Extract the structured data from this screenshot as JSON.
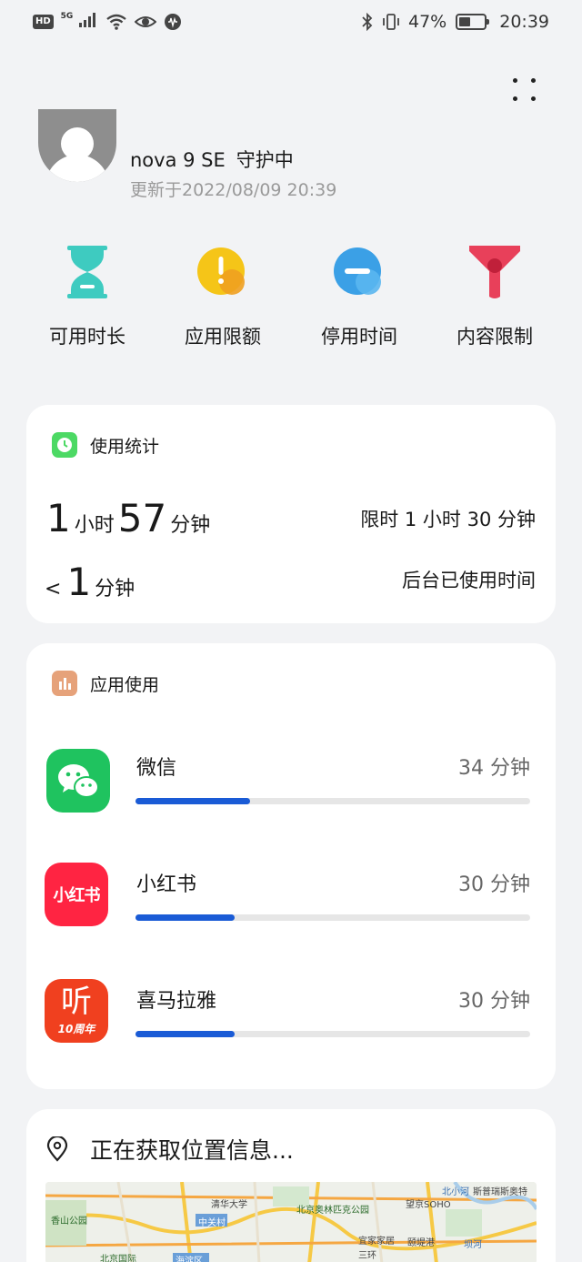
{
  "status_bar": {
    "hd": "HD",
    "signal_label": "5G",
    "battery_text": "47%",
    "battery_level": 0.47,
    "time": "20:39"
  },
  "device": {
    "name": "nova 9 SE",
    "status": "守护中",
    "updated": "更新于2022/08/09 20:39"
  },
  "features": [
    {
      "label": "可用时长",
      "icon": "hourglass-icon",
      "color": "#3ecbc0"
    },
    {
      "label": "应用限额",
      "icon": "app-limit-icon",
      "color": "#f5c518"
    },
    {
      "label": "停用时间",
      "icon": "downtime-icon",
      "color": "#3ba0e6"
    },
    {
      "label": "内容限制",
      "icon": "content-filter-icon",
      "color": "#e8405a"
    }
  ],
  "usage_stats": {
    "title": "使用统计",
    "hours": "1",
    "hours_unit": "小时",
    "minutes": "57",
    "minutes_unit": "分钟",
    "limit_text": "限时 1 小时 30 分钟",
    "bg_prefix": "<",
    "bg_value": "1",
    "bg_unit": "分钟",
    "bg_label": "后台已使用时间",
    "accent": "#4cd964"
  },
  "app_usage": {
    "title": "应用使用",
    "accent": "#e6a27a",
    "apps": [
      {
        "name": "微信",
        "time": "34 分钟",
        "fraction": 0.29,
        "icon": "wechat-icon",
        "color": "#1fc35f"
      },
      {
        "name": "小红书",
        "time": "30 分钟",
        "fraction": 0.25,
        "icon": "xiaohongshu-icon",
        "color": "#ff2442",
        "icon_text": "小红书"
      },
      {
        "name": "喜马拉雅",
        "time": "30 分钟",
        "fraction": 0.25,
        "icon": "ximalaya-icon",
        "color": "#f0401f",
        "icon_text_main": "听",
        "icon_text_sub": "10周年"
      }
    ]
  },
  "location": {
    "title": "正在获取位置信息...",
    "icon": "location-pin-icon",
    "map_labels": [
      "香山公园",
      "清华大学",
      "北京奥林匹克公园",
      "望京SOHO",
      "斯普瑞斯奥特",
      "中关村",
      "北小河",
      "宜家家居",
      "颐堤港",
      "坝河",
      "北京国际",
      "海淀区",
      "三环"
    ]
  }
}
